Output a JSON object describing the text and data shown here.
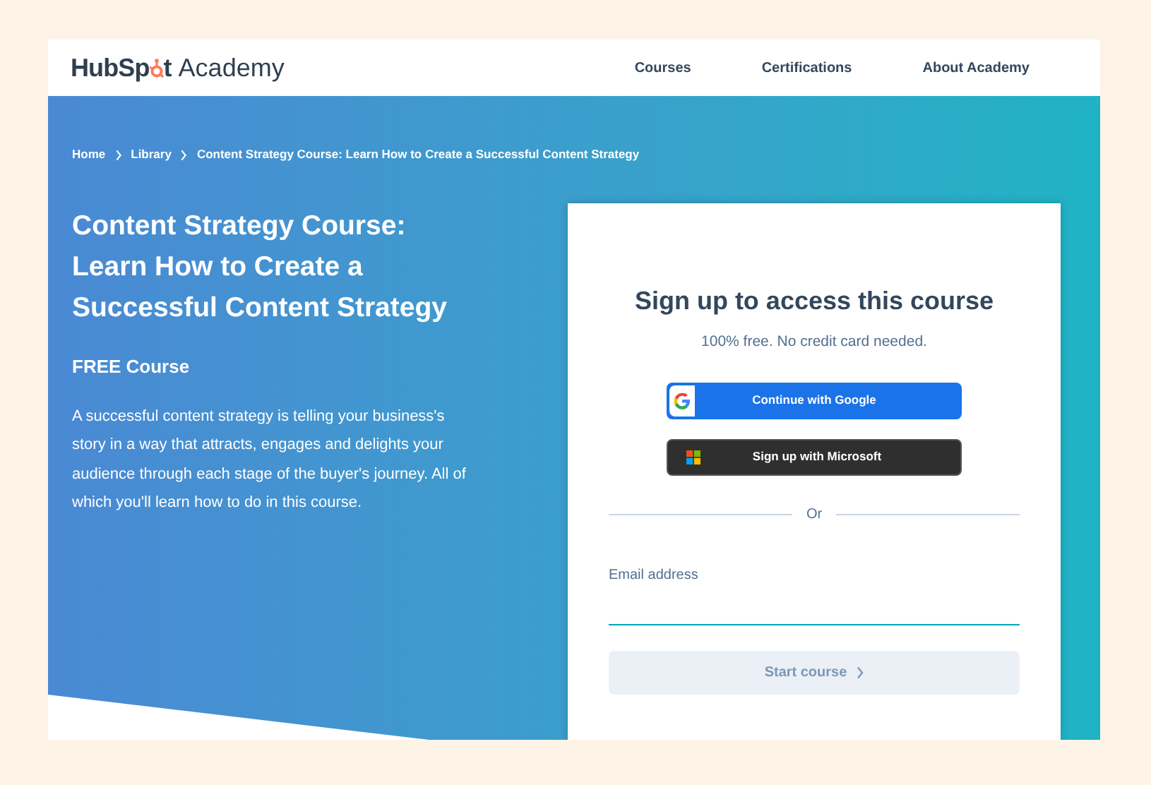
{
  "header": {
    "logo": {
      "brand_start": "HubSp",
      "brand_end": "t",
      "product": "Academy"
    },
    "nav": [
      {
        "label": "Courses"
      },
      {
        "label": "Certifications"
      },
      {
        "label": "About Academy"
      }
    ]
  },
  "breadcrumbs": [
    {
      "label": "Home"
    },
    {
      "label": "Library"
    },
    {
      "label": "Content Strategy Course: Learn How to Create a Successful Content Strategy"
    }
  ],
  "hero": {
    "title": "Content Strategy Course: Learn How to Create a Successful Content Strategy",
    "badge": "FREE Course",
    "description": "A successful content strategy is telling your business's story in a way that attracts, engages and delights your audience through each stage of the buyer's journey. All of which you'll learn how to do in this course."
  },
  "signup": {
    "title": "Sign up to access this course",
    "subtitle": "100% free. No credit card needed.",
    "providers": [
      {
        "kind": "google",
        "label": "Continue with Google"
      },
      {
        "kind": "microsoft",
        "label": "Sign up with Microsoft"
      }
    ],
    "divider": "Or",
    "email_label": "Email address",
    "submit": {
      "label": "Start course",
      "disabled": true
    }
  }
}
